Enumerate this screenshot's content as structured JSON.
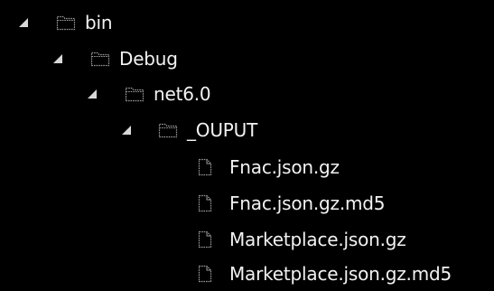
{
  "tree": {
    "nodes": [
      {
        "label": "bin",
        "type": "folder",
        "expanded": true,
        "icon": "folder-icon"
      },
      {
        "label": "Debug",
        "type": "folder",
        "expanded": true,
        "icon": "folder-icon"
      },
      {
        "label": "net6.0",
        "type": "folder",
        "expanded": true,
        "icon": "folder-icon"
      },
      {
        "label": "_OUPUT",
        "type": "folder",
        "expanded": true,
        "icon": "folder-icon"
      },
      {
        "label": "Fnac.json.gz",
        "type": "file",
        "icon": "file-icon"
      },
      {
        "label": "Fnac.json.gz.md5",
        "type": "file",
        "icon": "file-icon"
      },
      {
        "label": "Marketplace.json.gz",
        "type": "file",
        "icon": "file-icon"
      },
      {
        "label": "Marketplace.json.gz.md5",
        "type": "file",
        "icon": "file-icon"
      }
    ]
  },
  "colors": {
    "background": "#000000",
    "text": "#f2f2f2",
    "icon_stroke": "#9a9a9a",
    "chevron": "#d8d8d8"
  }
}
